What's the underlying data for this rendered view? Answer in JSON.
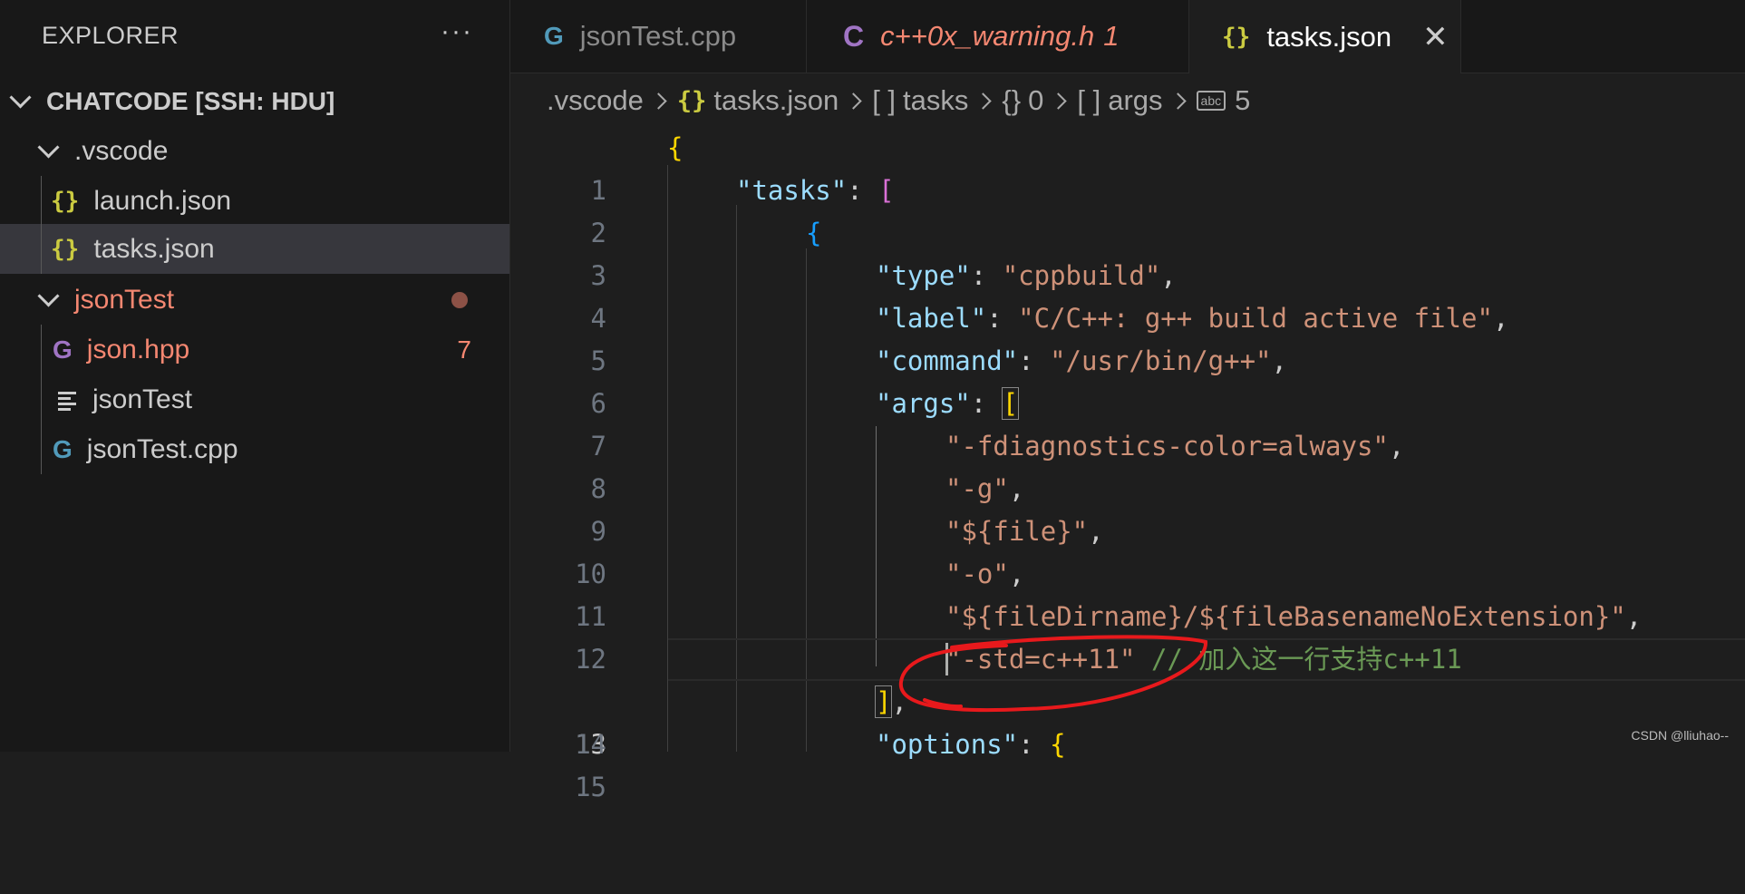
{
  "sidebar": {
    "title": "EXPLORER",
    "more": "···",
    "root": "CHATCODE [SSH: HDU]",
    "items": [
      {
        "label": ".vscode",
        "type": "folder"
      },
      {
        "label": "launch.json",
        "icon": "{}"
      },
      {
        "label": "tasks.json",
        "icon": "{}"
      },
      {
        "label": "jsonTest",
        "type": "folder"
      },
      {
        "label": "json.hpp",
        "icon": "G",
        "badge": "7"
      },
      {
        "label": "jsonTest",
        "icon": "lines"
      },
      {
        "label": "jsonTest.cpp",
        "icon": "G"
      }
    ]
  },
  "tabs": [
    {
      "label": "jsonTest.cpp",
      "icon": "G"
    },
    {
      "label": "c++0x_warning.h",
      "icon": "C",
      "badge": "1"
    },
    {
      "label": "tasks.json",
      "icon": "{}",
      "close": "✕"
    }
  ],
  "breadcrumb": {
    "folder": ".vscode",
    "file_icon": "{}",
    "file": "tasks.json",
    "arr_icon": "[ ]",
    "arr": "tasks",
    "obj_icon": "{}",
    "obj": "0",
    "arr2_icon": "[ ]",
    "arr2": "args",
    "str_icon": "abc",
    "str": "5"
  },
  "code": {
    "line_numbers": [
      "1",
      "2",
      "3",
      "4",
      "5",
      "6",
      "7",
      "8",
      "9",
      "10",
      "11",
      "12",
      "13",
      "14",
      "15"
    ],
    "l1_b": "{",
    "l2_k": "\"tasks\"",
    "l2_p": ": ",
    "l2_b": "[",
    "l3_b": "{",
    "l4_k": "\"type\"",
    "l4_p": ": ",
    "l4_s": "\"cppbuild\"",
    "l4_c": ",",
    "l5_k": "\"label\"",
    "l5_p": ": ",
    "l5_s": "\"C/C++: g++ build active file\"",
    "l5_c": ",",
    "l6_k": "\"command\"",
    "l6_p": ": ",
    "l6_s": "\"/usr/bin/g++\"",
    "l6_c": ",",
    "l7_k": "\"args\"",
    "l7_p": ": ",
    "l7_b": "[",
    "l8_s": "\"-fdiagnostics-color=always\"",
    "l8_c": ",",
    "l9_s": "\"-g\"",
    "l9_c": ",",
    "l10_s": "\"${file}\"",
    "l10_c": ",",
    "l11_s": "\"-o\"",
    "l11_c": ",",
    "l12_s": "\"${fileDirname}/${fileBasenameNoExtension}\"",
    "l12_c": ",",
    "l13_s": "\"-std=c++11\"",
    "l13_cm": " // 加入这一行支持c++11",
    "l14_b": "]",
    "l14_c": ",",
    "l15_k": "\"options\"",
    "l15_p": ": ",
    "l15_b": "{"
  },
  "colors": {
    "annotation": "#e8191c"
  },
  "watermark": "CSDN @lliuhao--"
}
